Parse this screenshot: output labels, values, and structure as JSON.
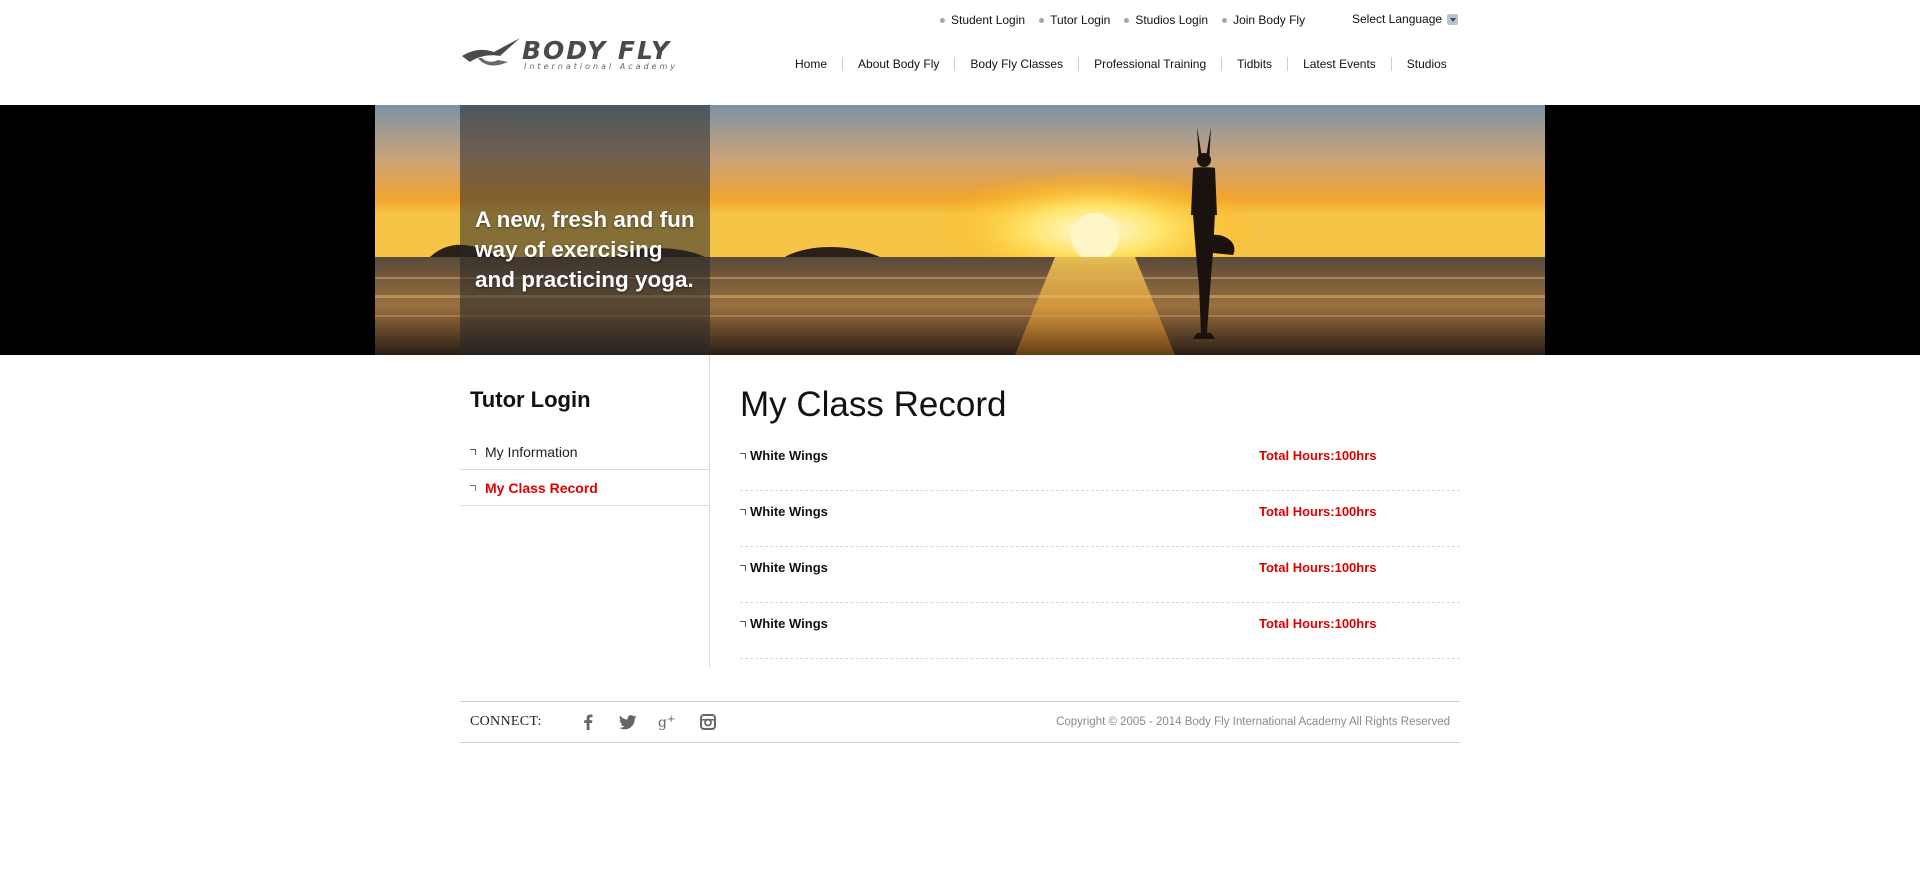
{
  "header": {
    "logo": {
      "text": "BODY FLY",
      "subtitle": "International Academy"
    },
    "top_links": [
      {
        "label": "Student Login"
      },
      {
        "label": "Tutor Login"
      },
      {
        "label": "Studios Login"
      },
      {
        "label": "Join Body Fly"
      }
    ],
    "language_select": {
      "label": "Select Language",
      "icon": "chevron-down-icon"
    },
    "nav": [
      {
        "label": "Home"
      },
      {
        "label": "About Body Fly"
      },
      {
        "label": "Body Fly Classes"
      },
      {
        "label": "Professional Training"
      },
      {
        "label": "Tidbits"
      },
      {
        "label": "Latest Events"
      },
      {
        "label": "Studios"
      }
    ]
  },
  "banner": {
    "tagline": "A new, fresh and fun way of exercising and practicing yoga."
  },
  "sidebar": {
    "title": "Tutor Login",
    "items": [
      {
        "label": "My Information",
        "active": false
      },
      {
        "label": "My Class Record",
        "active": true
      }
    ]
  },
  "main": {
    "title": "My Class Record",
    "records": [
      {
        "name": "White Wings",
        "hours": "Total Hours:100hrs"
      },
      {
        "name": "White Wings",
        "hours": "Total Hours:100hrs"
      },
      {
        "name": "White Wings",
        "hours": "Total Hours:100hrs"
      },
      {
        "name": "White Wings",
        "hours": "Total Hours:100hrs"
      }
    ]
  },
  "footer": {
    "connect_label": "CONNECT:",
    "social": [
      "facebook-icon",
      "twitter-icon",
      "google-plus-icon",
      "instagram-icon"
    ],
    "copyright": "Copyright © 2005 - 2014 Body Fly International Academy All Rights Reserved"
  },
  "colors": {
    "accent": "#e00000",
    "text": "#111111",
    "muted": "#8a8a8a"
  }
}
